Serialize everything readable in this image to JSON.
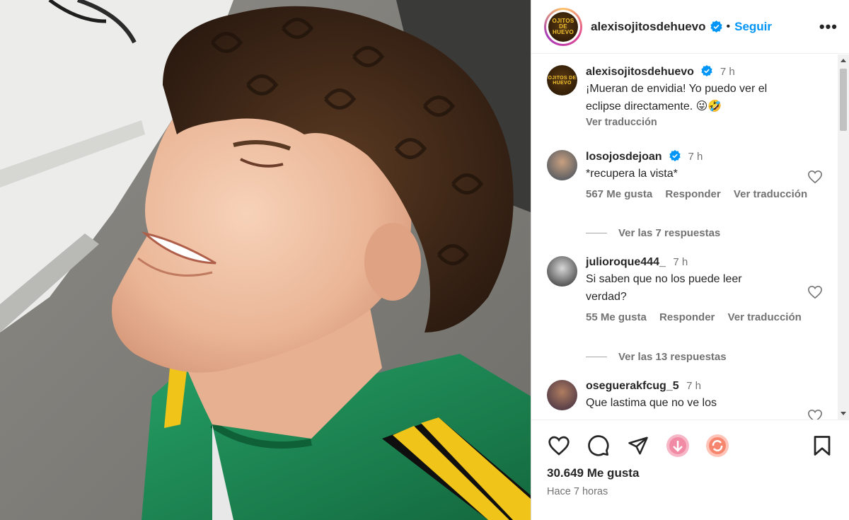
{
  "post": {
    "username": "alexisojitosdehuevo",
    "separator": "•",
    "follow_label": "Seguir",
    "more_label": "•••",
    "avatar_text": "OJITOS DE HUEVO"
  },
  "caption": {
    "username": "alexisojitosdehuevo",
    "time": "7 h",
    "text": "¡Mueran de envidia! Yo puedo ver el eclipse directamente. 😜🤣",
    "translate": "Ver traducción"
  },
  "comments": [
    {
      "username": "losojosdejoan",
      "verified": true,
      "time": "7 h",
      "text": "*recupera la vista*",
      "likes": "567 Me gusta",
      "reply": "Responder",
      "translate": "Ver traducción",
      "replies": "Ver las 7 respuestas"
    },
    {
      "username": "julioroque444_",
      "verified": false,
      "time": "7 h",
      "text": "Si saben que no los puede leer verdad?",
      "likes": "55 Me gusta",
      "reply": "Responder",
      "translate": "Ver traducción",
      "replies": "Ver las 13 respuestas"
    },
    {
      "username": "oseguerakfcug_5",
      "verified": false,
      "time": "7 h",
      "text": "Que lastima que no ve los"
    }
  ],
  "footer": {
    "likes": "30.649 Me gusta",
    "posted": "Hace 7 horas"
  },
  "colors": {
    "accent": "#0095f6",
    "verified": "#0095f6",
    "text": "#262626",
    "muted": "#737373",
    "jacket_green": "#1f8a55",
    "stripe_yellow": "#f0c419"
  },
  "icons": [
    "like-icon",
    "comment-icon",
    "share-icon",
    "sticker-icon",
    "remix-icon",
    "bookmark-icon",
    "more-icon",
    "verified-icon"
  ]
}
